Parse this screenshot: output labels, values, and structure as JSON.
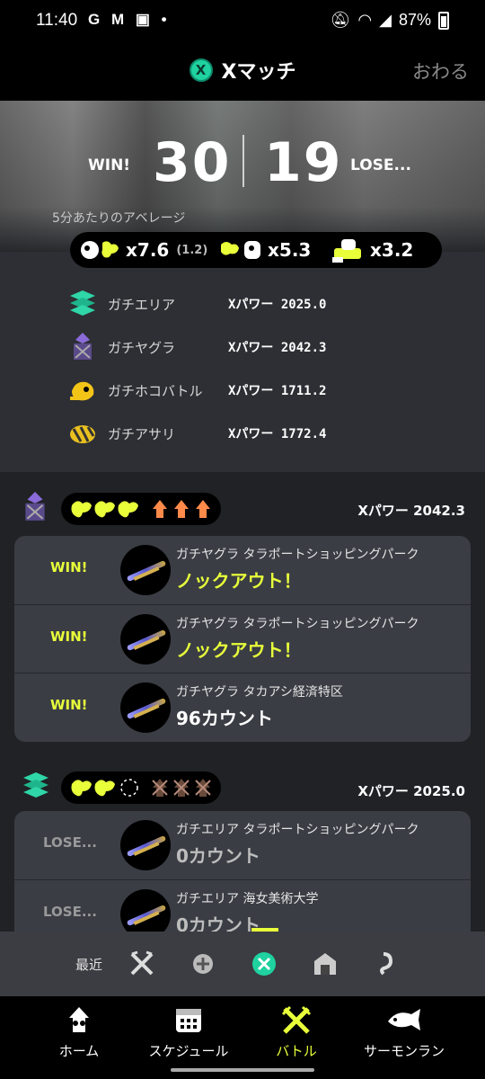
{
  "status_bar": {
    "time": "11:40",
    "left_icons": "G M ▣ •",
    "battery": "87%"
  },
  "header": {
    "title": "Xマッチ",
    "badge": "X",
    "close": "おわる"
  },
  "summary": {
    "win_label": "WIN!",
    "wins": "30",
    "losses": "19",
    "lose_label": "LOSE...",
    "average_label": "5分あたりのアベレージ",
    "kills": "x7.6",
    "assists": "(1.2)",
    "deaths": "x5.3",
    "specials": "x3.2"
  },
  "modes": [
    {
      "name": "ガチエリア",
      "power": "Xパワー 2025.0",
      "icon": "splat-zones-icon"
    },
    {
      "name": "ガチヤグラ",
      "power": "Xパワー 2042.3",
      "icon": "tower-control-icon"
    },
    {
      "name": "ガチホコバトル",
      "power": "Xパワー 1711.2",
      "icon": "rainmaker-icon"
    },
    {
      "name": "ガチアサリ",
      "power": "Xパワー 1772.4",
      "icon": "clam-blitz-icon"
    }
  ],
  "sections": [
    {
      "power": "Xパワー 2042.3",
      "matches": [
        {
          "result": "WIN!",
          "title": "ガチヤグラ タラポートショッピングパーク",
          "score": "ノックアウト！"
        },
        {
          "result": "WIN!",
          "title": "ガチヤグラ タラポートショッピングパーク",
          "score": "ノックアウト！"
        },
        {
          "result": "WIN!",
          "title": "ガチヤグラ タカアシ経済特区",
          "score": "96カウント"
        }
      ]
    },
    {
      "power": "Xパワー 2025.0",
      "matches": [
        {
          "result": "LOSE...",
          "title": "ガチエリア タラポートショッピングパーク",
          "score": "0カウント"
        },
        {
          "result": "LOSE...",
          "title": "ガチエリア 海女美術大学",
          "score": "0カウント"
        }
      ]
    }
  ],
  "recent": {
    "label": "最近"
  },
  "nav": {
    "home": "ホーム",
    "schedule": "スケジュール",
    "battle": "バトル",
    "salmon": "サーモンラン"
  },
  "colors": {
    "accent": "#e8ff3a",
    "xmatch": "#1fd2a0",
    "orange": "#ff8a4a"
  }
}
